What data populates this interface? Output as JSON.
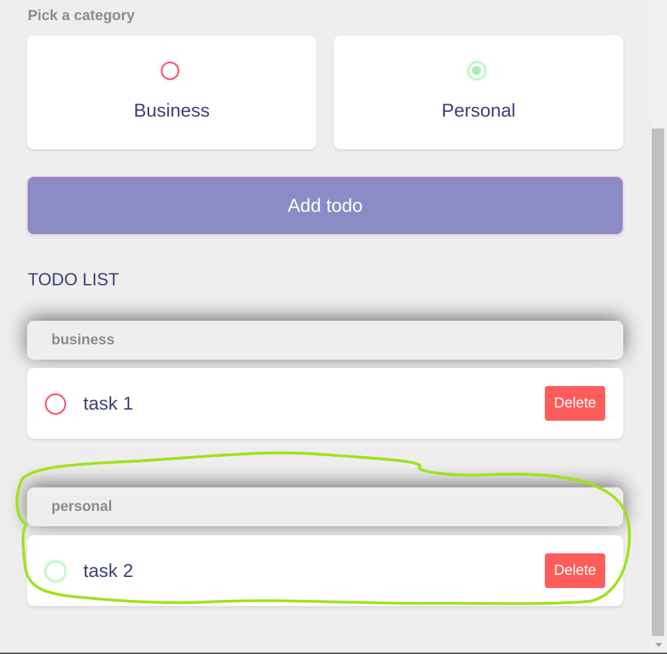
{
  "category_picker": {
    "heading": "Pick a category",
    "options": [
      {
        "label": "Business",
        "selected": false,
        "color": "#e84a63"
      },
      {
        "label": "Personal",
        "selected": true,
        "color": "#a6f0ae"
      }
    ]
  },
  "add_button": {
    "label": "Add todo"
  },
  "todo_list": {
    "heading": "TODO LIST",
    "groups": [
      {
        "name": "business",
        "items": [
          {
            "text": "task 1",
            "delete_label": "Delete",
            "category_color": "#e84a63"
          }
        ]
      },
      {
        "name": "personal",
        "items": [
          {
            "text": "task 2",
            "delete_label": "Delete",
            "category_color": "#a6f0ae"
          }
        ]
      }
    ]
  },
  "colors": {
    "accent_button": "#8b8bc6",
    "delete_button": "#ff5c5c",
    "text_primary": "#3e3f77",
    "annotation_highlight": "#9ee31b"
  }
}
